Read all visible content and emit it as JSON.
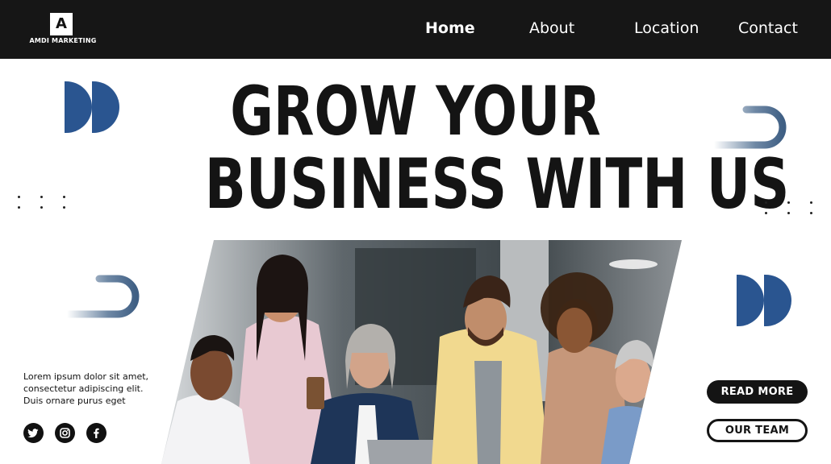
{
  "brand": {
    "logo_letter": "A",
    "name": "AMDI MARKETING"
  },
  "nav": {
    "home": "Home",
    "about": "About",
    "location": "Location",
    "contact": "Contact"
  },
  "hero": {
    "line1": "GROW YOUR",
    "line2": "BUSINESS WITH US"
  },
  "blurb": {
    "line1": "Lorem ipsum dolor sit amet,",
    "line2": "consectetur adipiscing elit.",
    "line3": "Duis ornare purus eget"
  },
  "buttons": {
    "read_more": "READ MORE",
    "our_team": "OUR TEAM"
  },
  "social_icons": [
    "twitter-icon",
    "instagram-icon",
    "facebook-icon"
  ],
  "colors": {
    "nav_bg": "#161616",
    "accent_blue": "#2a5590",
    "text_dark": "#141414"
  }
}
